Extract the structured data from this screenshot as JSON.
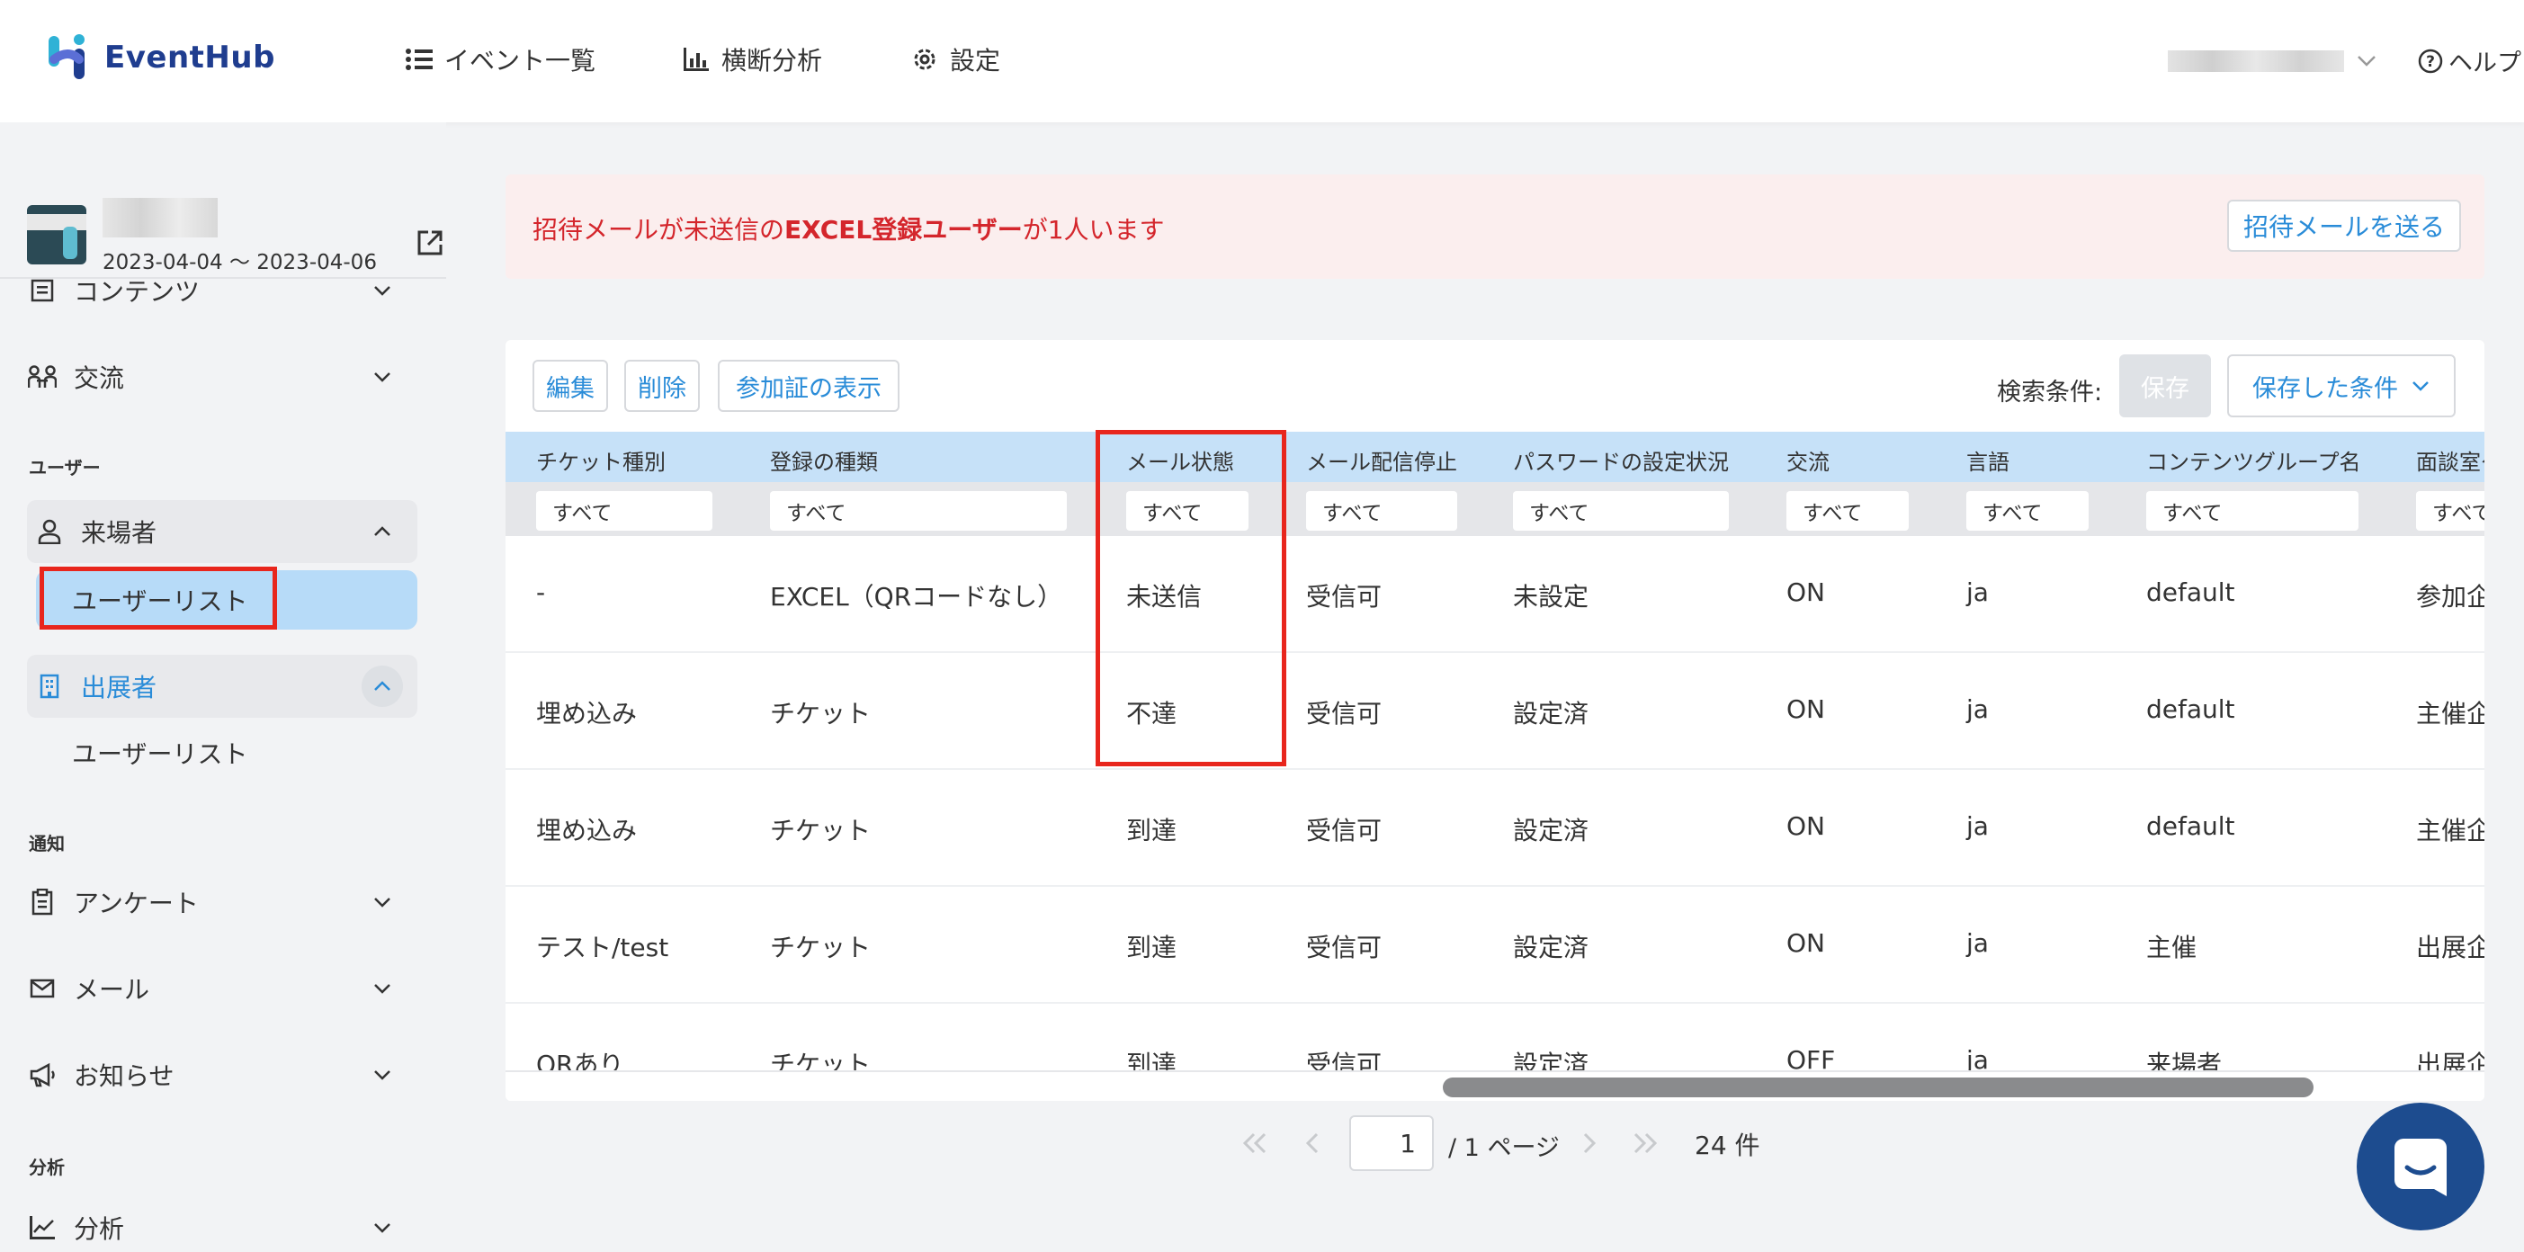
{
  "app": {
    "name": "EventHub"
  },
  "nav": {
    "events": "イベント一覧",
    "analysis": "横断分析",
    "settings": "設定",
    "help": "ヘルプ"
  },
  "event": {
    "date_range": "2023-04-04 ～ 2023-04-06"
  },
  "sidebar": {
    "contents": "コンテンツ",
    "exchange": "交流",
    "section_user": "ユーザー",
    "visitor": "来場者",
    "visitor_user_list": "ユーザーリスト",
    "exhibitor": "出展者",
    "exhibitor_user_list": "ユーザーリスト",
    "section_notify": "通知",
    "survey": "アンケート",
    "mail": "メール",
    "notice": "お知らせ",
    "section_analysis": "分析",
    "analytics": "分析"
  },
  "alert": {
    "part1": "招待メールが未送信の",
    "bold": "EXCEL登録ユーザー",
    "part2": "が1人います",
    "button": "招待メールを送る"
  },
  "toolbar": {
    "edit": "編集",
    "delete": "削除",
    "show_badge": "参加証の表示",
    "search_label": "検索条件:",
    "save": "保存",
    "saved_conditions": "保存した条件"
  },
  "table": {
    "headers": [
      "チケット種別",
      "登録の種類",
      "メール状態",
      "メール配信停止",
      "パスワードの設定状況",
      "交流",
      "言語",
      "コンテンツグループ名",
      "面談室グ"
    ],
    "filter_value": "すべて",
    "rows": [
      [
        "-",
        "EXCEL（QRコードなし）",
        "未送信",
        "受信可",
        "未設定",
        "ON",
        "ja",
        "default",
        "参加企"
      ],
      [
        "埋め込み",
        "チケット",
        "不達",
        "受信可",
        "設定済",
        "ON",
        "ja",
        "default",
        "主催企"
      ],
      [
        "埋め込み",
        "チケット",
        "到達",
        "受信可",
        "設定済",
        "ON",
        "ja",
        "default",
        "主催企"
      ],
      [
        "テスト/test",
        "チケット",
        "到達",
        "受信可",
        "設定済",
        "ON",
        "ja",
        "主催",
        "出展企"
      ],
      [
        "QRあり",
        "チケット",
        "到達",
        "受信可",
        "設定済",
        "OFF",
        "ja",
        "来場者",
        "出展企"
      ]
    ]
  },
  "pagination": {
    "current_page": "1",
    "total_pages": "/ 1 ページ",
    "count": "24 件"
  },
  "colors": {
    "brand": "#1f3d8f",
    "accent": "#2a8cd8",
    "alert_bg": "#fbeeee",
    "alert_text": "#d4262c",
    "highlight_box": "#e8261d",
    "header_row": "#c6e1f8"
  }
}
